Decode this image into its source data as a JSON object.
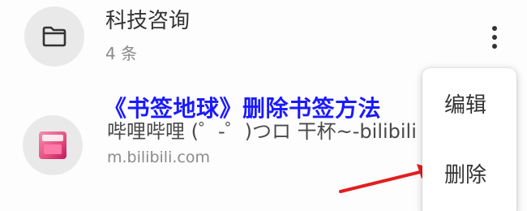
{
  "folder": {
    "title": "科技咨询",
    "count": "4 条",
    "icon": "folder-icon"
  },
  "bookmark": {
    "title": "哔哩哔哩 (゜-゜)つロ 干杯~-bilibili",
    "url": "m.bilibili.com",
    "icon": "bilibili-favicon"
  },
  "menu": {
    "edit_label": "编辑",
    "delete_label": "删除"
  },
  "overlay": {
    "headline": "《书签地球》删除书签方法",
    "headline_color": "#1a1aff"
  },
  "annotation": {
    "arrow_color": "#e02020",
    "arrow_icon": "red-arrow-icon"
  }
}
